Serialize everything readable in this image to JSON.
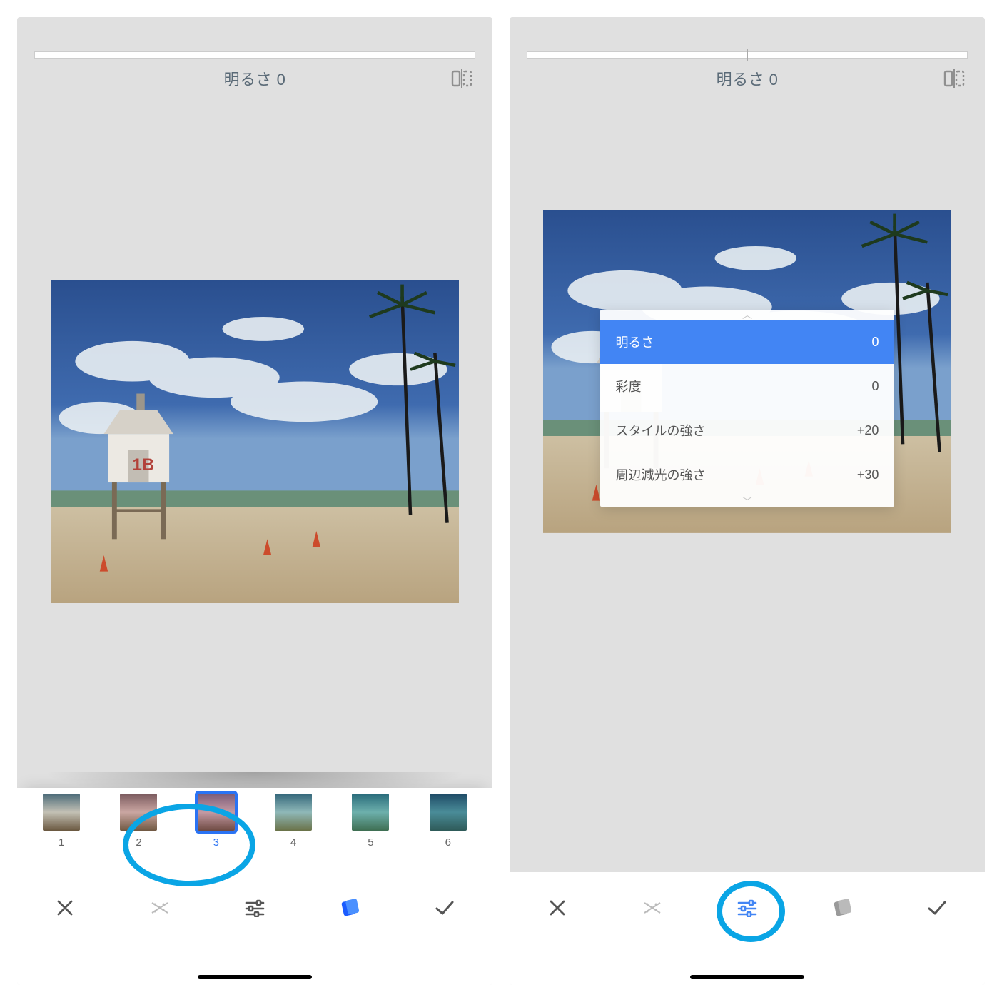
{
  "left": {
    "slider_label": "明るさ 0",
    "presets": [
      {
        "n": "1"
      },
      {
        "n": "2"
      },
      {
        "n": "3"
      },
      {
        "n": "4"
      },
      {
        "n": "5"
      },
      {
        "n": "6"
      }
    ],
    "selected_preset_index": 2
  },
  "right": {
    "slider_label": "明るさ 0",
    "adjust": [
      {
        "label": "明るさ",
        "value": "0",
        "selected": true
      },
      {
        "label": "彩度",
        "value": "0"
      },
      {
        "label": "スタイルの強さ",
        "value": "+20"
      },
      {
        "label": "周辺減光の強さ",
        "value": "+30"
      }
    ]
  },
  "icons": {
    "compare": "compare-icon",
    "close": "close-icon",
    "random": "shuffle-icon",
    "tune": "tune-icon",
    "palette": "palette-icon",
    "apply": "check-icon"
  },
  "colors": {
    "accent": "#4285f4",
    "highlight": "#0aa5e5",
    "muted": "#8f8f8f"
  }
}
